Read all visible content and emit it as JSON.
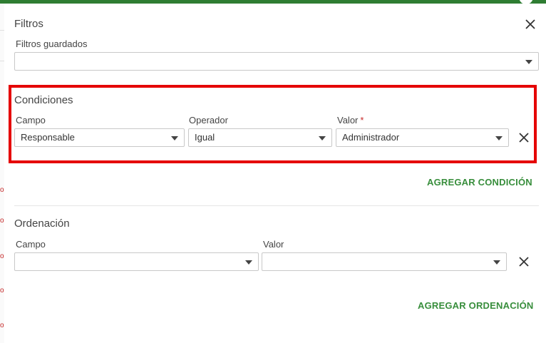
{
  "dialog": {
    "title": "Filtros",
    "saved_filters": {
      "label": "Filtros guardados",
      "value": ""
    }
  },
  "conditions": {
    "title": "Condiciones",
    "campo": {
      "label": "Campo",
      "value": "Responsable"
    },
    "operador": {
      "label": "Operador",
      "value": "Igual"
    },
    "valor": {
      "label": "Valor",
      "required_mark": "*",
      "value": "Administrador"
    },
    "add_label": "AGREGAR CONDICIÓN"
  },
  "ordering": {
    "title": "Ordenación",
    "campo": {
      "label": "Campo",
      "value": ""
    },
    "valor": {
      "label": "Valor",
      "value": ""
    },
    "add_label": "AGREGAR ORDENACIÓN"
  },
  "colors": {
    "accent_green": "#388e3c",
    "highlight_red": "#e50000",
    "top_bar": "#2e7d32"
  },
  "icons": {
    "close": "close-icon",
    "remove": "remove-icon",
    "dropdown": "chevron-down-icon"
  }
}
